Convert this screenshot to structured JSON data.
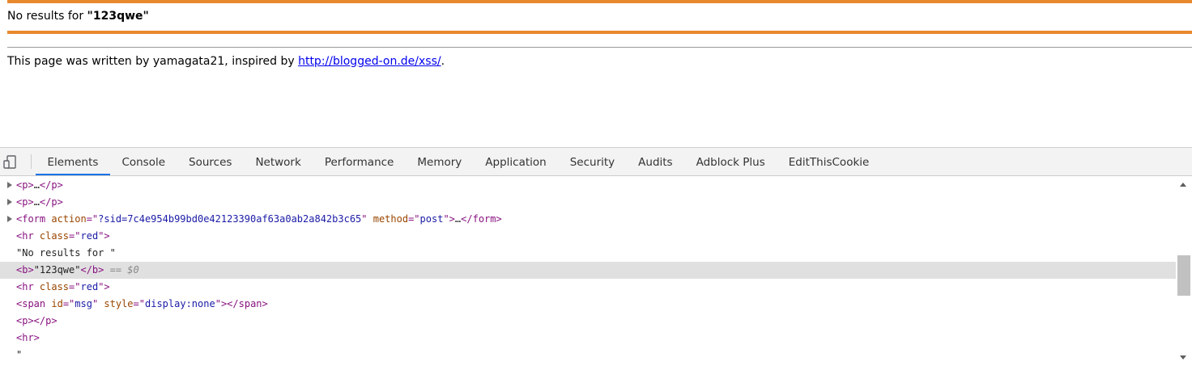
{
  "page": {
    "result_prefix": "No results for ",
    "result_query": "\"123qwe\"",
    "credit_text": "This page was written by yamagata21, inspired by ",
    "credit_link": "http://blogged-on.de/xss/",
    "credit_suffix": "."
  },
  "devtools": {
    "device_icon": "device-toggle-icon",
    "tabs": [
      "Elements",
      "Console",
      "Sources",
      "Network",
      "Performance",
      "Memory",
      "Application",
      "Security",
      "Audits",
      "Adblock Plus",
      "EditThisCookie"
    ],
    "active_tab": "Elements",
    "dom": {
      "p1_open": "<p>",
      "p1_ellipsis": "…",
      "p1_close": "</p>",
      "p2_open": "<p>",
      "p2_ellipsis": "…",
      "p2_close": "</p>",
      "form_open": "<form",
      "form_attr1_name": " action",
      "form_attr1_eq": "=\"",
      "form_attr1_val": "?sid=7c4e954b99bd0e42123390af63a0ab2a842b3c65",
      "form_attr1_q": "\"",
      "form_attr2_name": " method",
      "form_attr2_eq": "=\"",
      "form_attr2_val": "post",
      "form_attr2_q": "\"",
      "form_gt": ">",
      "form_ellipsis": "…",
      "form_close": "</form>",
      "hr1_open": "<hr",
      "hr1_attr": " class",
      "hr1_eq": "=\"",
      "hr1_val": "red",
      "hr1_close": "\">",
      "text_node": "\"No results for \"",
      "b_open": "<b>",
      "b_text": "\"123qwe\"",
      "b_close": "</b>",
      "b_marker": " == $0",
      "hr2_open": "<hr",
      "hr2_attr": " class",
      "hr2_eq": "=\"",
      "hr2_val": "red",
      "hr2_close": "\">",
      "span_open": "<span",
      "span_attr1": " id",
      "span_eq1": "=\"",
      "span_val1": "msg",
      "span_q1": "\"",
      "span_attr2": " style",
      "span_eq2": "=\"",
      "span_val2": "display:none",
      "span_q2": "\"",
      "span_gt": ">",
      "span_close": "</span>",
      "p3": "<p></p>",
      "hr3": "<hr>",
      "quote": "\""
    }
  },
  "colors": {
    "accent_orange": "#e8892e",
    "link_blue": "#0000ee",
    "tab_active_underline": "#1a73e8",
    "tag_purple": "#881280",
    "attr_brown": "#994500",
    "value_blue": "#1a1aa6"
  }
}
